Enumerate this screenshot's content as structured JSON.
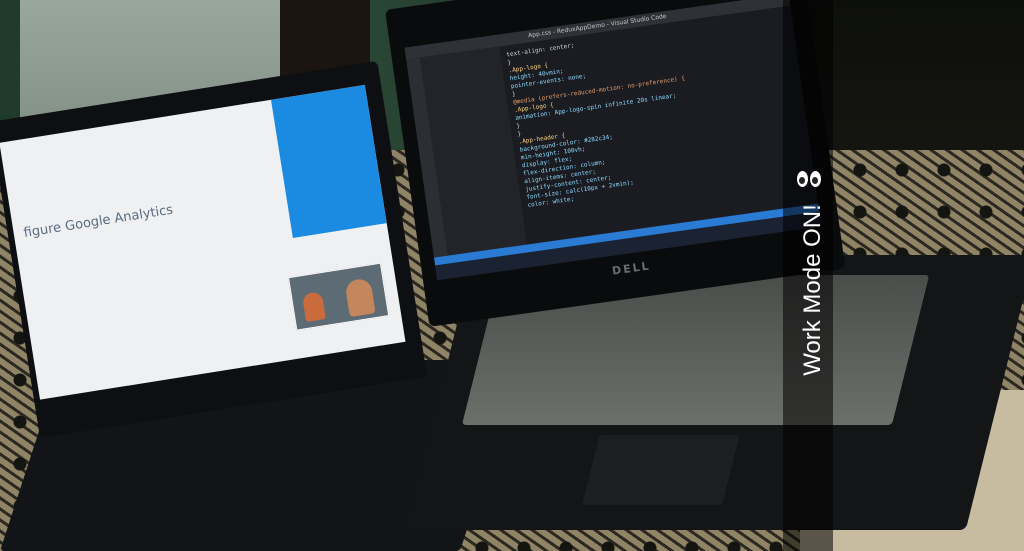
{
  "overlay": {
    "caption": "Work Mode ON!",
    "emoji": "eyes-emoji"
  },
  "left_laptop": {
    "page_heading": "figure Google Analytics"
  },
  "right_laptop": {
    "title_bar": "App.css - ReduxAppDemo - Visual Studio Code",
    "brand": "DELL",
    "code_lines": [
      "  text-align: center;",
      "}",
      ".App-logo {",
      "  height: 40vmin;",
      "  pointer-events: none;",
      "}",
      "@media (prefers-reduced-motion: no-preference) {",
      "  .App-logo {",
      "    animation: App-logo-spin infinite 20s linear;",
      "  }",
      "}",
      ".App-header {",
      "  background-color: #282c34;",
      "  min-height: 100vh;",
      "  display: flex;",
      "  flex-direction: column;",
      "  align-items: center;",
      "  justify-content: center;",
      "  font-size: calc(10px + 2vmin);",
      "  color: white;"
    ]
  }
}
